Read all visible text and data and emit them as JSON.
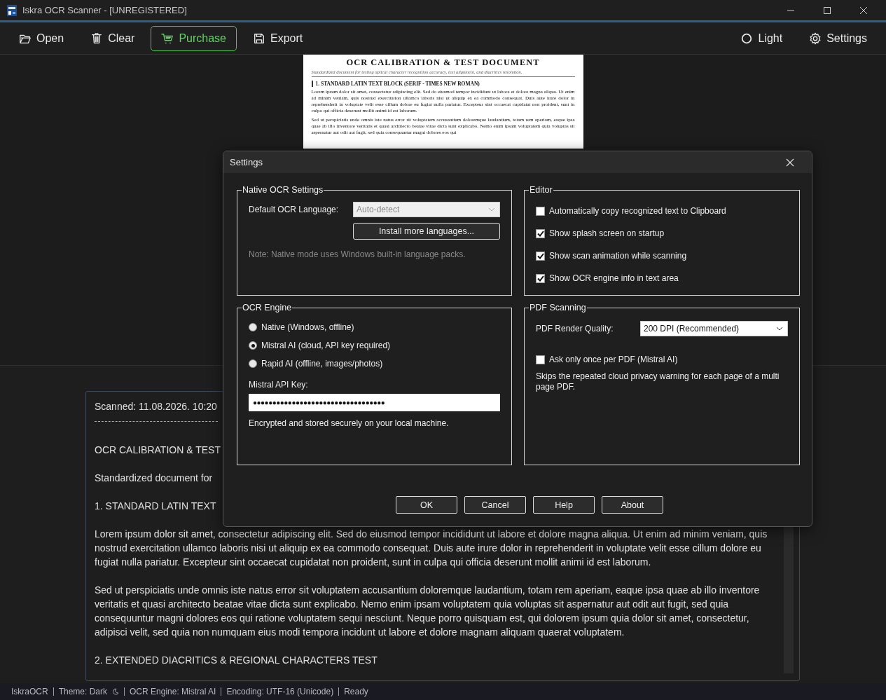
{
  "window": {
    "title": "Iskra OCR Scanner - [UNREGISTERED]"
  },
  "toolbar": {
    "left": [
      {
        "label": "Open",
        "kind": "plain"
      },
      {
        "label": "Clear",
        "kind": "plain"
      },
      {
        "label": "Purchase",
        "kind": "highlight"
      },
      {
        "label": "Export",
        "kind": "plain"
      }
    ],
    "right": [
      {
        "label": "Light",
        "kind": "plain"
      },
      {
        "label": "Settings",
        "kind": "plain"
      }
    ]
  },
  "preview": {
    "title": "OCR CALIBRATION & TEST DOCUMENT",
    "subtitle": "Standardized document for testing optical character recognition accuracy, text alignment, and diacritics resolution.",
    "heading": "1. STANDARD LATIN TEXT BLOCK (SERIF - TIMES NEW ROMAN)",
    "paragraphs": [
      "Lorem ipsum dolor sit amet, consectetur adipiscing elit. Sed do eiusmod tempor incididunt ut labore et dolore magna aliqua. Ut enim ad minim veniam, quis nostrud exercitation ullamco laboris nisi ut aliquip ex ea commodo consequat. Duis aute irure dolor in reprehenderit in voluptate velit esse cillum dolore eu fugiat nulla pariatur. Excepteur sint occaecat cupidatat non proident, sunt in culpa qui officia deserunt mollit animi id est laborum.",
      "Sed ut perspiciatis unde omnis iste natus error sit voluptatem accusantium doloremque laudantium, totam rem aperiam, eaque ipsa quae ab illo inventore veritatis et quasi architecto beatae vitae dicta sunt explicabo. Nemo enim ipsam voluptatem quia voluptas sit aspernatur aut odit aut fugit, sed quia consequuntur magni dolores eos qui"
    ]
  },
  "text_panel": {
    "scanned": "Scanned: 11.08.2026. 10:20",
    "lines": [
      "OCR CALIBRATION & TEST",
      "Standardized document for",
      "1. STANDARD LATIN TEXT",
      "Lorem ipsum dolor sit amet, consectetur adipiscing elit. Sed do eiusmod tempor incididunt ut labore et dolore magna aliqua. Ut enim ad minim veniam, quis nostrud exercitation ullamco laboris nisi ut aliquip ex ea commodo consequat. Duis aute irure dolor in reprehenderit in voluptate velit esse cillum dolore eu fugiat nulla pariatur. Excepteur sint occaecat cupidatat non proident, sunt in culpa qui officia deserunt mollit animi id est laborum.",
      "Sed ut perspiciatis unde omnis iste natus error sit voluptatem accusantium doloremque laudantium, totam rem aperiam, eaque ipsa quae ab illo inventore veritatis et quasi architecto beatae vitae dicta sunt explicabo. Nemo enim ipsam voluptatem quia voluptas sit aspernatur aut odit aut fugit, sed quia consequuntur magni dolores eos qui ratione voluptatem sequi nesciunt. Neque porro quisquam est, qui dolorem ipsum quia dolor sit amet, consectetur, adipisci velit, sed quia non numquam eius modi tempora incidunt ut labore et dolore magnam aliquam quaerat voluptatem.",
      "2. EXTENDED DIACRITICS & REGIONAL CHARACTERS TEST"
    ]
  },
  "dialog": {
    "title": "Settings",
    "native_ocr": {
      "legend": "Native OCR Settings",
      "language_label": "Default OCR Language:",
      "language_value": "Auto-detect",
      "language_disabled": true,
      "install_button": "Install more languages...",
      "note": "Note: Native mode uses Windows built-in language packs."
    },
    "ocr_engine": {
      "legend": "OCR Engine",
      "options": [
        {
          "label": "Native (Windows, offline)",
          "selected": false
        },
        {
          "label": "Mistral AI (cloud, API key required)",
          "selected": true
        },
        {
          "label": "Rapid AI (offline, images/photos)",
          "selected": false
        }
      ],
      "api_key_label": "Mistral API Key:",
      "api_key_value": "●●●●●●●●●●●●●●●●●●●●●●●●●●●●●●●●●●",
      "api_key_hint": "Encrypted and stored securely on your local machine."
    },
    "editor": {
      "legend": "Editor",
      "options": [
        {
          "label": "Automatically copy recognized text to Clipboard",
          "checked": false
        },
        {
          "label": "Show splash screen on startup",
          "checked": true
        },
        {
          "label": "Show scan animation while scanning",
          "checked": true
        },
        {
          "label": "Show OCR engine info in text area",
          "checked": true
        }
      ]
    },
    "pdf": {
      "legend": "PDF Scanning",
      "quality_label": "PDF Render Quality:",
      "quality_value": "200 DPI (Recommended)",
      "ask_once": {
        "label": "Ask only once per PDF (Mistral AI)",
        "checked": false
      },
      "hint": "Skips the repeated cloud privacy warning for each page of a multi page PDF."
    },
    "buttons": [
      "OK",
      "Cancel",
      "Help",
      "About"
    ]
  },
  "status_bar": [
    "IskraOCR",
    "Theme: Dark",
    "OCR Engine: Mistral AI",
    "Encoding: UTF-16 (Unicode)",
    "Ready"
  ]
}
